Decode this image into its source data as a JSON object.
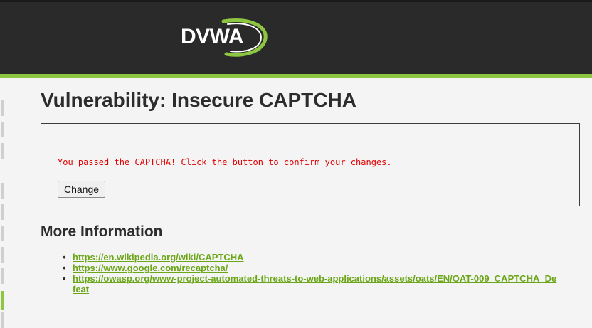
{
  "header": {
    "logo_text": "DVWA",
    "accent_color": "#8dc63f",
    "background_color": "#2a2a2a"
  },
  "main": {
    "title": "Vulnerability: Insecure CAPTCHA",
    "vuln_box": {
      "message": "You passed the CAPTCHA! Click the button to confirm your changes.",
      "button_label": "Change"
    },
    "more_info": {
      "heading": "More Information",
      "links": [
        {
          "text": "https://en.wikipedia.org/wiki/CAPTCHA"
        },
        {
          "text": "https://www.google.com/recaptcha/"
        },
        {
          "text": "https://owasp.org/www-project-automated-threats-to-web-applications/assets/oats/EN/OAT-009_CAPTCHA_Defeat"
        }
      ]
    }
  },
  "colors": {
    "message_color": "#e00000",
    "link_color": "#6aa617"
  }
}
